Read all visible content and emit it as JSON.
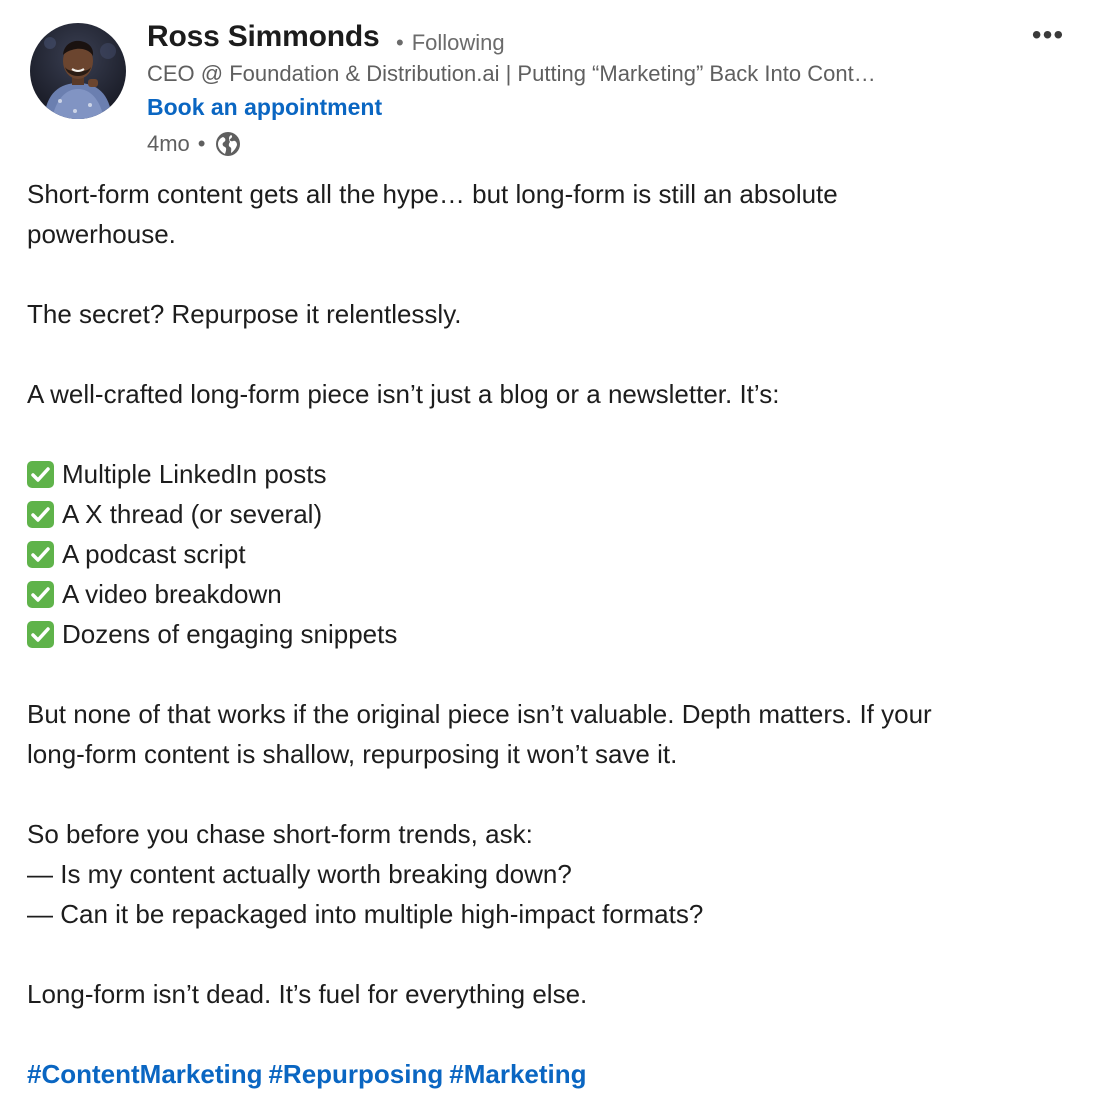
{
  "author": {
    "name": "Ross Simmonds",
    "follow_separator": "•",
    "follow_status": "Following",
    "headline": "CEO @ Foundation & Distribution.ai | Putting “Marketing” Back Into Cont…",
    "cta_link": "Book an appointment",
    "time_ago": "4mo",
    "meta_separator": "•",
    "visibility_icon": "globe-icon",
    "avatar_icon": "avatar-photo"
  },
  "menu": {
    "more_label": "•••",
    "more_icon": "more-horizontal-icon"
  },
  "post": {
    "para1": [
      "Short-form content gets all the hype… but long-form is still an absolute",
      "powerhouse."
    ],
    "para2": "The secret? Repurpose it relentlessly.",
    "para3": "A well-crafted long-form piece isn’t just a blog or a newsletter. It’s:",
    "checklist": [
      "Multiple LinkedIn posts",
      "A X thread (or several)",
      "A podcast script",
      "A video breakdown",
      "Dozens of engaging snippets"
    ],
    "checklist_icon": "check-mark-button-icon",
    "para4": [
      "But none of that works if the original piece isn’t valuable. Depth matters. If your",
      "long-form content is shallow, repurposing it won’t save it."
    ],
    "para5": [
      "So before you chase short-form trends, ask:",
      "— Is my content actually worth breaking down?",
      "— Can it be repackaged into multiple high-impact formats?"
    ],
    "para6": "Long-form isn’t dead. It’s fuel for everything else.",
    "hashtags": [
      "#ContentMarketing",
      "#Repurposing",
      "#Marketing"
    ]
  },
  "colors": {
    "link_blue": "#0a66c2",
    "text": "#1d1d1d",
    "muted": "#5f5f5f",
    "check_green": "#5fb34a"
  }
}
